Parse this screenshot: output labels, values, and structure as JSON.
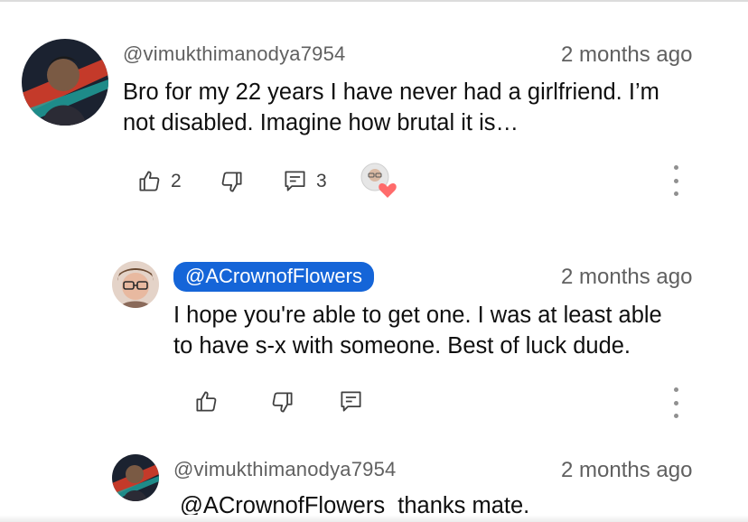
{
  "comments": [
    {
      "username": "@vimukthimanodya7954",
      "time": "2 months ago",
      "text_line1": "Bro for my 22 years I have never had a girlfriend. I’m",
      "text_line2": "not disabled. Imagine how brutal it is…",
      "likes": "2",
      "replies": "3"
    },
    {
      "username": "@ACrownofFlowers",
      "time": "2 months ago",
      "text_line1": "I hope you're able to get one. I was at least able",
      "text_line2": "to have s-x with someone. Best of luck dude."
    },
    {
      "username": "@vimukthimanodya7954",
      "time": "2 months ago",
      "text_line1": "@ACrownofFlowers  thanks mate."
    }
  ],
  "icons": {
    "like": "thumb-up-icon",
    "dislike": "thumb-down-icon",
    "reply": "comment-icon",
    "more": "more-vert-icon",
    "creator_heart": "heart-icon"
  },
  "colors": {
    "mention_chip": "#1565d8",
    "heart": "#ff6b6b"
  }
}
